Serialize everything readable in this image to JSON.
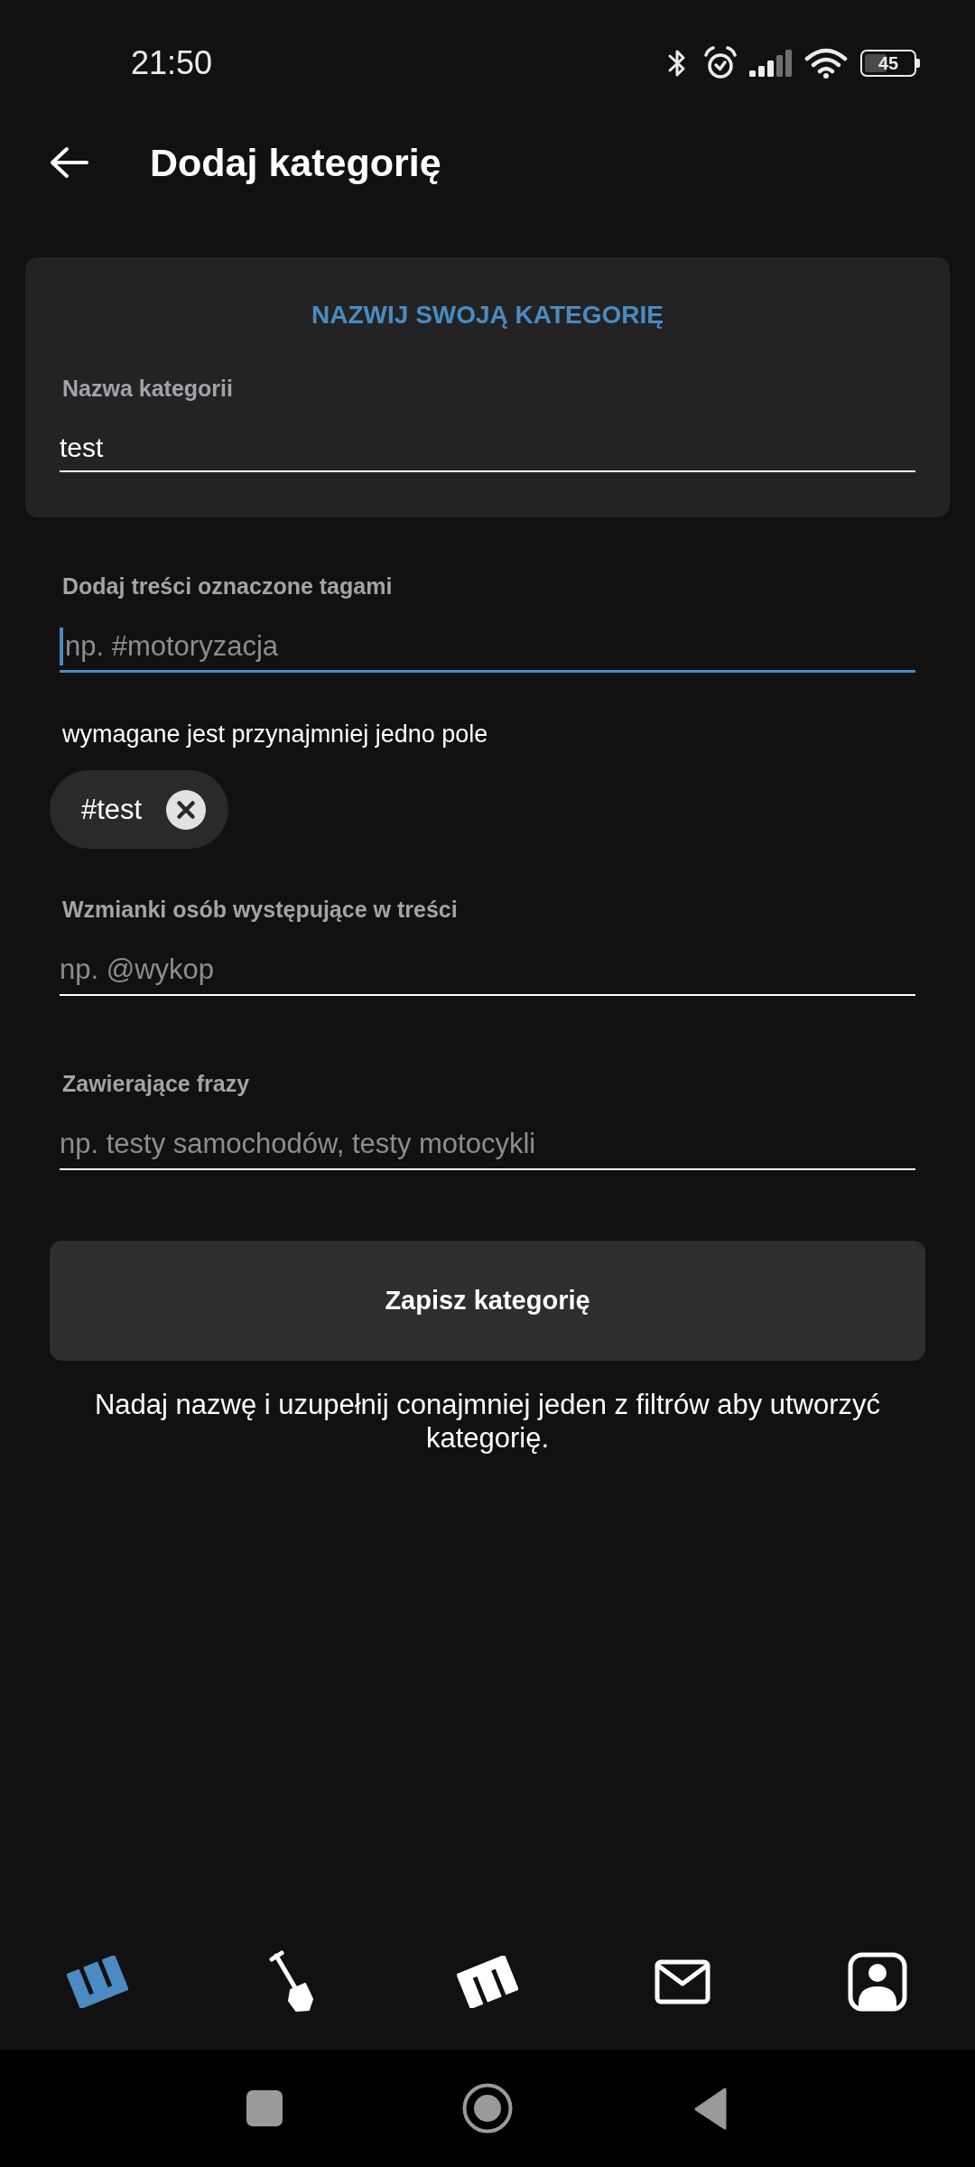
{
  "status_bar": {
    "time": "21:50",
    "battery": "45"
  },
  "app_bar": {
    "title": "Dodaj kategorię"
  },
  "name_card": {
    "heading": "NAZWIJ SWOJĄ KATEGORIĘ",
    "label": "Nazwa kategorii",
    "value": "test"
  },
  "filters": [
    {
      "label": "Dodaj treści oznaczone tagami",
      "placeholder": "np. #motoryzacja",
      "focused": true,
      "helper": "wymagane jest przynajmniej jedno pole",
      "chips": [
        {
          "label": "#test"
        }
      ]
    },
    {
      "label": "Wzmianki osób występujące w treści",
      "placeholder": "np. @wykop",
      "focused": false
    },
    {
      "label": "Zawierające frazy",
      "placeholder": "np. testy samochodów, testy motocykli",
      "focused": false
    }
  ],
  "save_button": {
    "label": "Zapisz kategorię"
  },
  "hint": "Nadaj nazwę i uzupełnij conajmniej jeden z filtrów aby utworzyć kategorię.",
  "bottom_nav": [
    {
      "selected": true
    },
    {
      "selected": false
    },
    {
      "selected": false
    },
    {
      "selected": false
    },
    {
      "selected": false
    }
  ]
}
